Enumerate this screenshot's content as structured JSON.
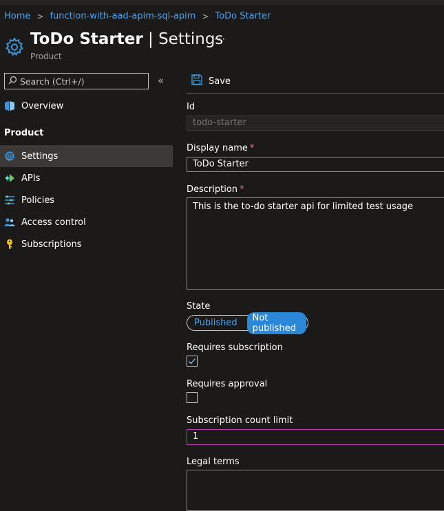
{
  "breadcrumb": {
    "items": [
      "Home",
      "function-with-aad-apim-sql-apim",
      "ToDo Starter"
    ],
    "separator": ">"
  },
  "header": {
    "title_strong": "ToDo Starter",
    "title_rest": " | Settings",
    "subtitle": "Product",
    "more": "···"
  },
  "sidebar": {
    "search_placeholder": "Search (Ctrl+/)",
    "collapse": "«",
    "overview": "Overview",
    "section": "Product",
    "items": [
      {
        "label": "Settings",
        "icon": "gear-icon",
        "selected": true
      },
      {
        "label": "APIs",
        "icon": "apis-icon"
      },
      {
        "label": "Policies",
        "icon": "policies-icon"
      },
      {
        "label": "Access control",
        "icon": "people-icon"
      },
      {
        "label": "Subscriptions",
        "icon": "key-icon"
      }
    ]
  },
  "toolbar": {
    "save_label": "Save"
  },
  "form": {
    "id_label": "Id",
    "id_value": "todo-starter",
    "display_name_label": "Display name",
    "display_name_value": "ToDo Starter",
    "description_label": "Description",
    "description_value": "This is the to-do starter api for limited test usage",
    "required_marker": "*",
    "state_label": "State",
    "state_options": [
      "Published",
      "Not published"
    ],
    "state_selected": "Not published",
    "requires_subscription_label": "Requires subscription",
    "requires_subscription_checked": true,
    "requires_approval_label": "Requires approval",
    "requires_approval_checked": false,
    "subscription_count_label": "Subscription count limit",
    "subscription_count_value": "1",
    "legal_terms_label": "Legal terms"
  },
  "colors": {
    "background": "#1b1a19",
    "accent": "#4ca3f0",
    "toggle_on": "#2b88d8",
    "required": "#f1707b",
    "focus": "#c239b3"
  }
}
